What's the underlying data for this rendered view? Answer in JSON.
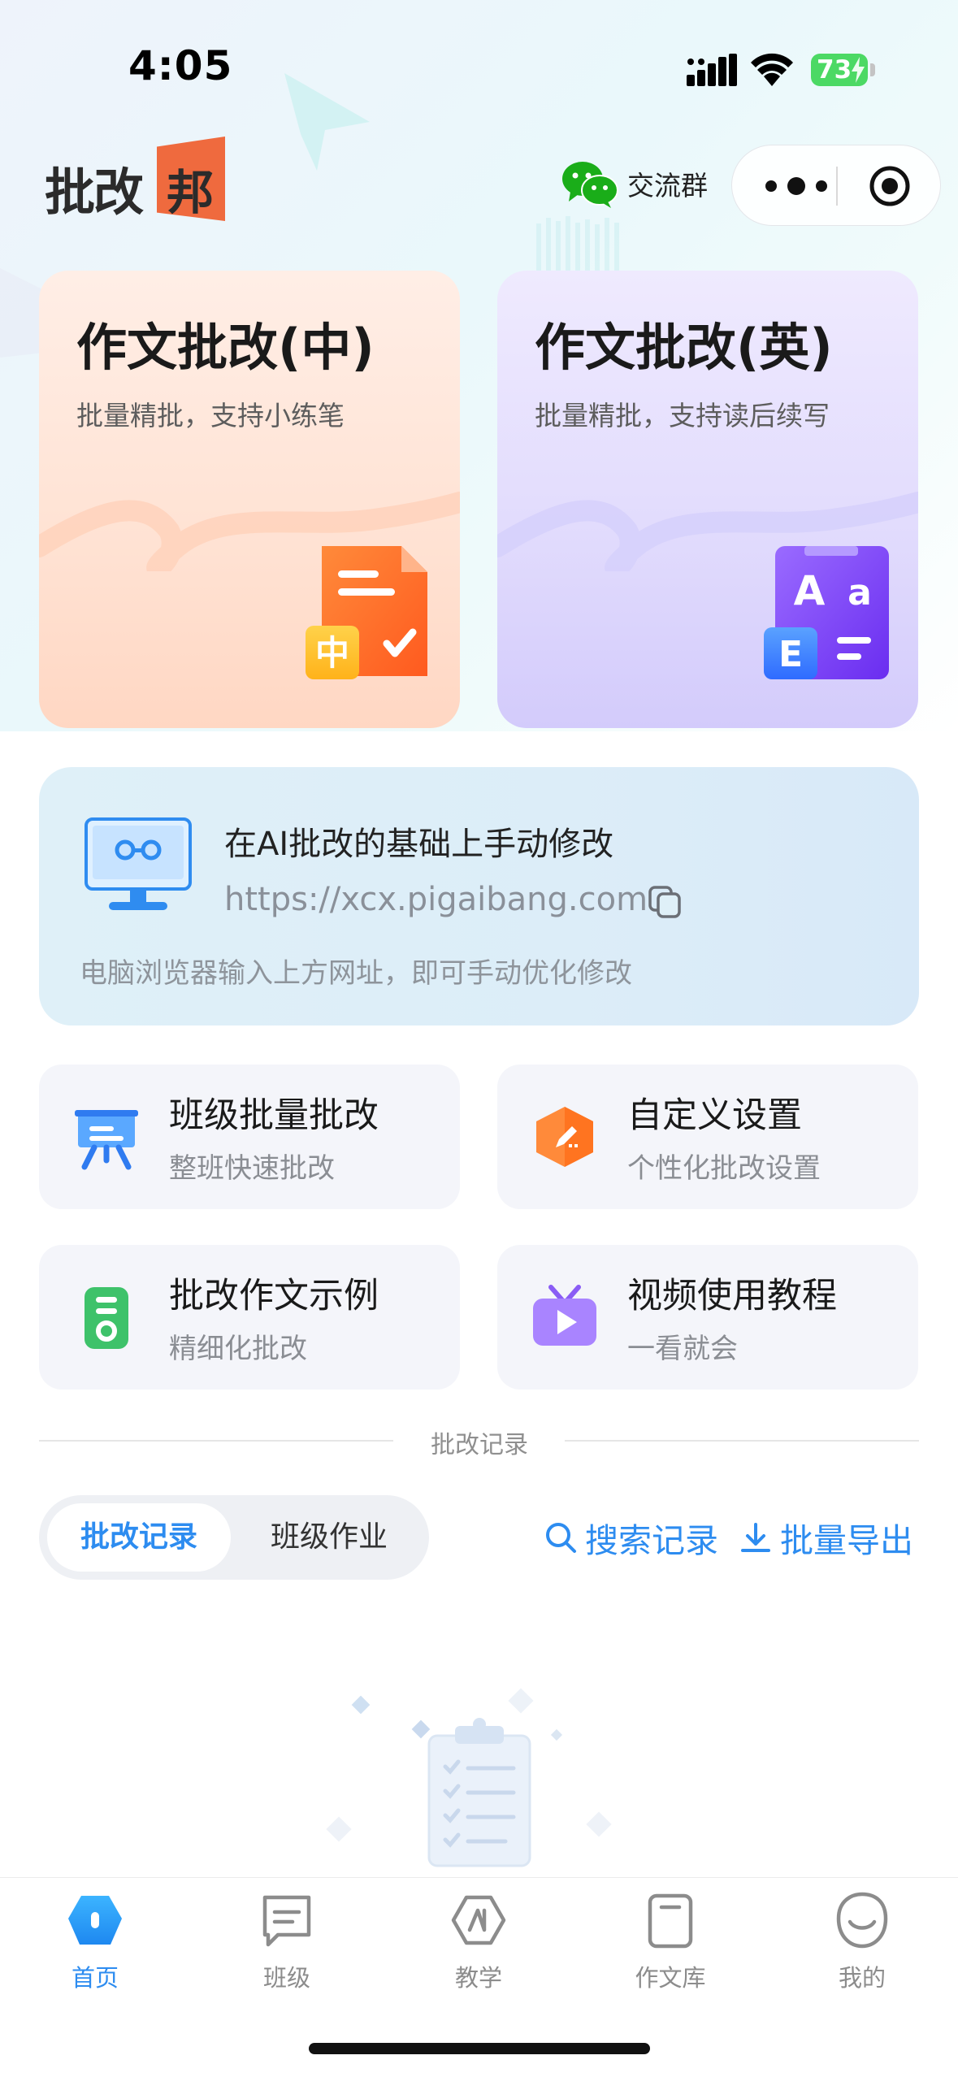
{
  "status_bar": {
    "time": "4:05",
    "battery": "73"
  },
  "header": {
    "logo_text": "批改",
    "logo_flag_text": "邦",
    "wechat_label": "交流群"
  },
  "cards": {
    "chinese": {
      "title": "作文批改(中)",
      "subtitle": "批量精批，支持小练笔",
      "badge": "中"
    },
    "english": {
      "title": "作文批改(英)",
      "subtitle": "批量精批，支持读后续写",
      "badge_a": "A",
      "badge_a2": "a",
      "badge_e": "E"
    }
  },
  "web_banner": {
    "title": "在AI批改的基础上手动修改",
    "url": "https://xcx.pigaibang.com",
    "hint": "电脑浏览器输入上方网址，即可手动优化修改"
  },
  "features": [
    {
      "title": "班级批量批改",
      "subtitle": "整班快速批改",
      "icon": "class-board-icon"
    },
    {
      "title": "自定义设置",
      "subtitle": "个性化批改设置",
      "icon": "edit-hexagon-icon"
    },
    {
      "title": "批改作文示例",
      "subtitle": "精细化批改",
      "icon": "document-example-icon"
    },
    {
      "title": "视频使用教程",
      "subtitle": "一看就会",
      "icon": "video-tv-icon"
    }
  ],
  "records": {
    "divider_label": "批改记录",
    "segments": [
      "批改记录",
      "班级作业"
    ],
    "active_segment": 0,
    "search_label": "搜索记录",
    "export_label": "批量导出"
  },
  "tabbar": {
    "active": 0,
    "items": [
      {
        "label": "首页",
        "icon": "home-icon"
      },
      {
        "label": "班级",
        "icon": "class-icon"
      },
      {
        "label": "教学",
        "icon": "teaching-icon"
      },
      {
        "label": "作文库",
        "icon": "essay-library-icon"
      },
      {
        "label": "我的",
        "icon": "profile-icon"
      }
    ]
  },
  "colors": {
    "accent": "#2d8cf0",
    "orange": "#ff7a2f",
    "purple": "#7a4bff",
    "battery": "#4cd964",
    "wechat": "#1aad19"
  }
}
